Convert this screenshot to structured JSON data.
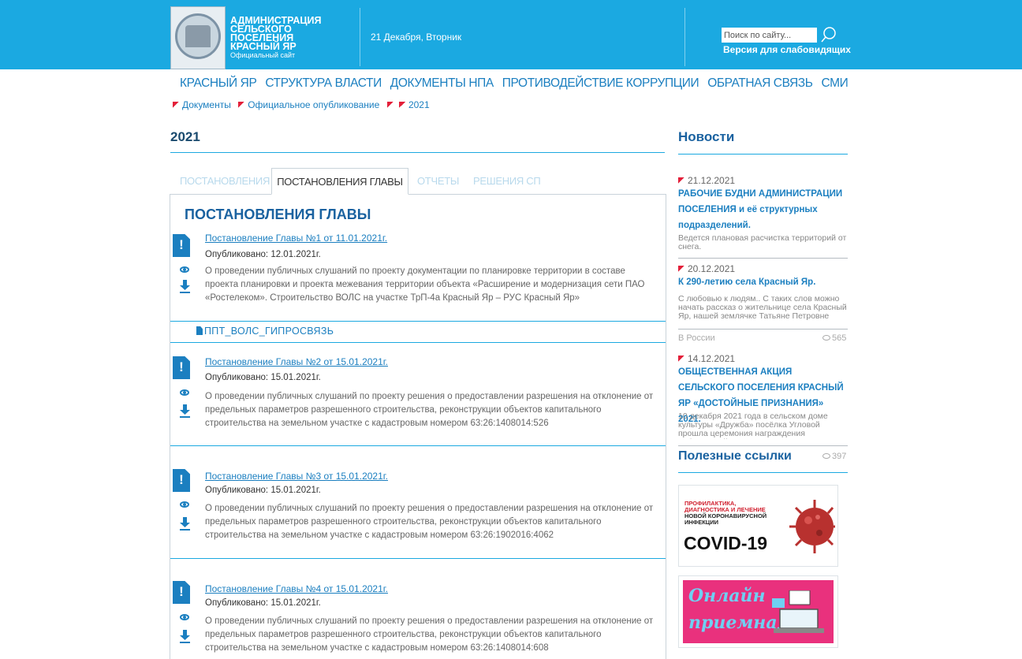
{
  "header": {
    "title_lines": [
      "АДМИНИСТРАЦИЯ",
      "СЕЛЬСКОГО ПОСЕЛЕНИЯ",
      "КРАСНЫЙ ЯР"
    ],
    "subtitle": "Официальный сайт",
    "date": "21 Декабря, Вторник",
    "search_placeholder": "Поиск по сайту...",
    "vision_link": "Версия для слабовидящих",
    "accent_color": "#1ba9e1"
  },
  "nav": {
    "items": [
      "КРАСНЫЙ ЯР",
      "СТРУКТУРА ВЛАСТИ",
      "ДОКУМЕНТЫ НПА",
      "ПРОТИВОДЕЙСТВИЕ КОРРУПЦИИ",
      "ОБРАТНАЯ СВЯЗЬ",
      "СМИ"
    ]
  },
  "breadcrumb": {
    "items": [
      "Документы",
      "Официальное опубликование",
      "2021"
    ]
  },
  "main": {
    "title": "2021",
    "tabs": [
      "ПОСТАНОВЛЕНИЯ",
      "ПОСТАНОВЛЕНИЯ ГЛАВЫ",
      "ОТЧЕТЫ",
      "РЕШЕНИЯ СП"
    ],
    "active_tab": "ПОСТАНОВЛЕНИЯ ГЛАВЫ",
    "panel_title": "ПОСТАНОВЛЕНИЯ ГЛАВЫ",
    "documents": [
      {
        "link": "Постановление Главы №1 от 11.01.2021г.",
        "published": "Опубликовано: 12.01.2021г.",
        "description": "О проведении публичных слушаний по проекту документации по планировке территории в составе проекта планировки и проекта межевания территории объекта «Расширение и модернизация сети ПАО «Ростелеком». Строительство ВОЛС на участке ТрП-4а Красный Яр – РУС Красный Яр»"
      },
      {
        "link": "Постановление Главы №2 от 15.01.2021г.",
        "published": "Опубликовано: 15.01.2021г.",
        "description": "О проведении публичных слушаний по проекту решения о предоставлении разрешения на отклонение от предельных параметров разрешенного строительства, реконструкции объектов капитального строительства на земельном участке с кадастровым номером 63:26:1408014:526"
      },
      {
        "link": "Постановление Главы №3 от 15.01.2021г.",
        "published": "Опубликовано: 15.01.2021г.",
        "description": "О проведении публичных слушаний по проекту решения о предоставлении разрешения на отклонение от предельных параметров разрешенного строительства, реконструкции объектов капитального строительства на земельном участке с кадастровым номером 63:26:1902016:4062"
      },
      {
        "link": "Постановление Главы №4 от 15.01.2021г.",
        "published": "Опубликовано: 15.01.2021г.",
        "description": "О проведении публичных слушаний по проекту решения о предоставлении разрешения на отклонение от предельных параметров разрешенного строительства, реконструкции объектов капитального строительства на земельном участке с кадастровым номером 63:26:1408014:608"
      }
    ],
    "attachment": "ППТ_ВОЛС_ГИПРОСВЯЗЬ"
  },
  "sidebar": {
    "news_title": "Новости",
    "news": [
      {
        "date": "21.12.2021",
        "title": "РАБОЧИЕ БУДНИ АДМИНИСТРАЦИИ ПОСЕЛЕНИЯ и её структурных подразделений.",
        "text": "Ведется плановая расчистка территорий от снега."
      },
      {
        "date": "20.12.2021",
        "title": "К 290-летию села Красный Яр.",
        "text": "С любовью к людям.. С таких слов можно начать рассказ о жительнице села Красный Яр, нашей землячке Татьяне Петровне",
        "category": "В России",
        "views": "565"
      },
      {
        "date": "14.12.2021",
        "title": "ОБЩЕСТВЕННАЯ АКЦИЯ СЕЛЬСКОГО ПОСЕЛЕНИЯ КРАСНЫЙ ЯР «ДОСТОЙНЫЕ ПРИЗНАНИЯ» 2021.",
        "text": "10 декабря 2021 года в сельском доме культуры «Дружба» посёлка Угловой прошла церемония награждения победителей",
        "views": "397"
      }
    ],
    "useful_title": "Полезные ссылки",
    "covid_banner": {
      "line1": "ПРОФИЛАКТИКА,",
      "line2": "ДИАГНОСТИКА И ЛЕЧЕНИЕ",
      "line3": "НОВОЙ КОРОНАВИРУСНОЙ",
      "line4": "ИНФЕКЦИИ",
      "big": "COVID-19"
    },
    "online_banner": {
      "line1": "Онлайн",
      "line2": "приемная"
    }
  }
}
